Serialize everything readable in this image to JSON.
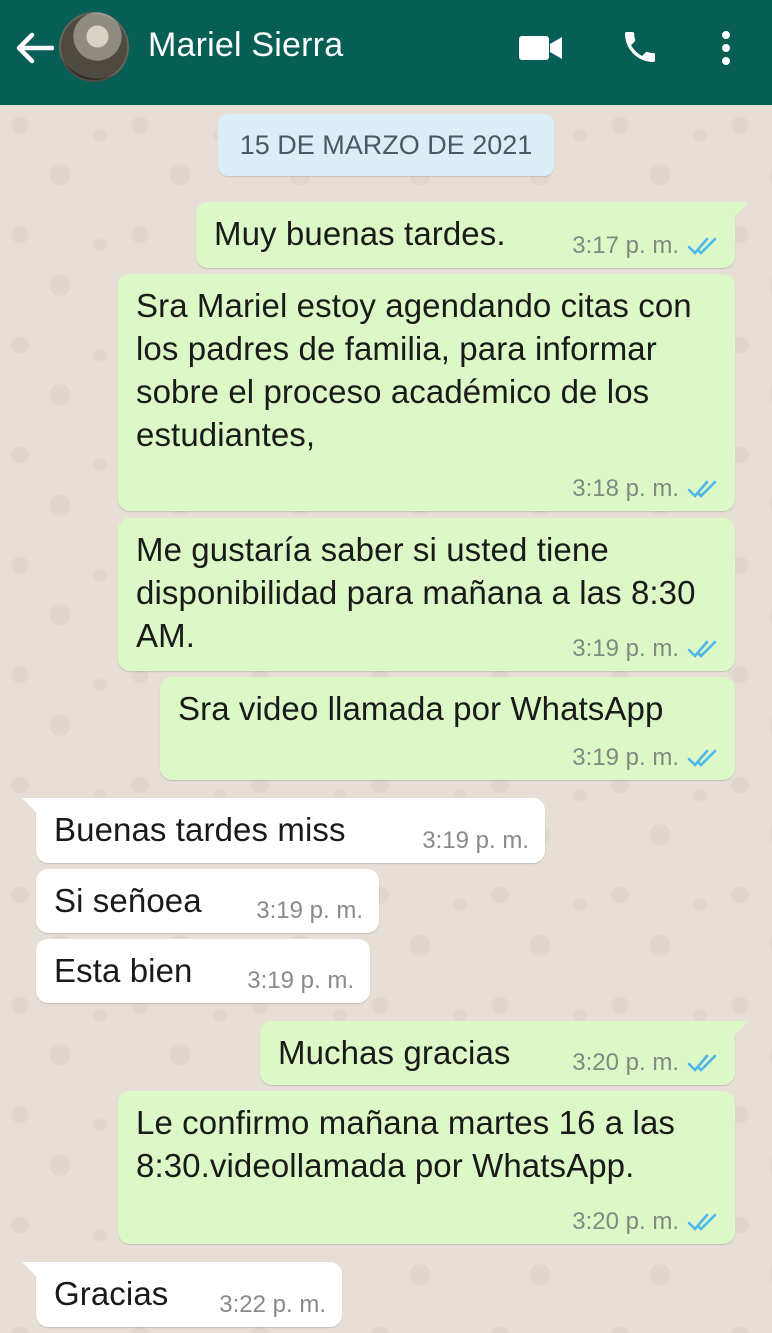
{
  "header": {
    "contact_name": "Mariel Sierra",
    "icons": [
      "arrow-back-icon",
      "avatar",
      "video-call-icon",
      "phone-icon",
      "more-vert-icon"
    ]
  },
  "chat": {
    "date_label": "15 DE MARZO DE 2021",
    "messages": [
      {
        "direction": "out",
        "text": "Muy buenas tardes.",
        "time": "3:17 p. m.",
        "read": true
      },
      {
        "direction": "out",
        "text": "Sra Mariel estoy agendando citas con los padres de familia, para informar sobre el proceso académico de los estudiantes,",
        "time": "3:18 p. m.",
        "read": true
      },
      {
        "direction": "out",
        "text": "Me gustaría saber si usted tiene disponibilidad para mañana a las 8:30 AM.",
        "time": "3:19 p. m.",
        "read": true
      },
      {
        "direction": "out",
        "text": "Sra video llamada por WhatsApp",
        "time": "3:19 p. m.",
        "read": true
      },
      {
        "direction": "in",
        "text": "Buenas tardes miss",
        "time": "3:19 p. m."
      },
      {
        "direction": "in",
        "text": "Si señoea",
        "time": "3:19 p. m."
      },
      {
        "direction": "in",
        "text": "Esta bien",
        "time": "3:19 p. m."
      },
      {
        "direction": "out",
        "text": "Muchas gracias",
        "time": "3:20 p. m.",
        "read": true
      },
      {
        "direction": "out",
        "text": "Le confirmo mañana martes 16 a las 8:30.videollamada por WhatsApp.",
        "time": "3:20 p. m.",
        "read": true
      },
      {
        "direction": "in",
        "text": "Gracias",
        "time": "3:22 p. m."
      }
    ]
  },
  "colors": {
    "header_bg": "#075e54",
    "outgoing_bubble": "#dcf8c6",
    "incoming_bubble": "#ffffff",
    "date_chip": "#dbeef7",
    "read_ticks": "#4fb6ec",
    "chat_bg": "#e7ded5"
  }
}
